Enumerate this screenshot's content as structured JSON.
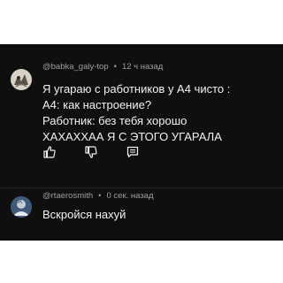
{
  "comments": [
    {
      "author": "@babka_galy-top",
      "separator": "•",
      "time": "12 ч назад",
      "lines": [
        "Я угараю с работников у А4 чисто :",
        "А4: как настроение?",
        "Работник: без тебя хорошо",
        "ХАХАХХАА Я С ЭТОГО УГАРАЛА"
      ],
      "actions": {
        "like_icon": "thumbs-up-icon",
        "dislike_icon": "thumbs-down-icon",
        "reply_icon": "reply-comment-icon"
      }
    },
    {
      "author": "@rtaerosmith",
      "separator": "•",
      "time": "0 сек. назад",
      "lines": [
        "Вскройся нахуй"
      ]
    }
  ],
  "colors": {
    "background": "#0f0f0f",
    "text": "#f1f1f1",
    "meta": "#9e9e9e"
  }
}
